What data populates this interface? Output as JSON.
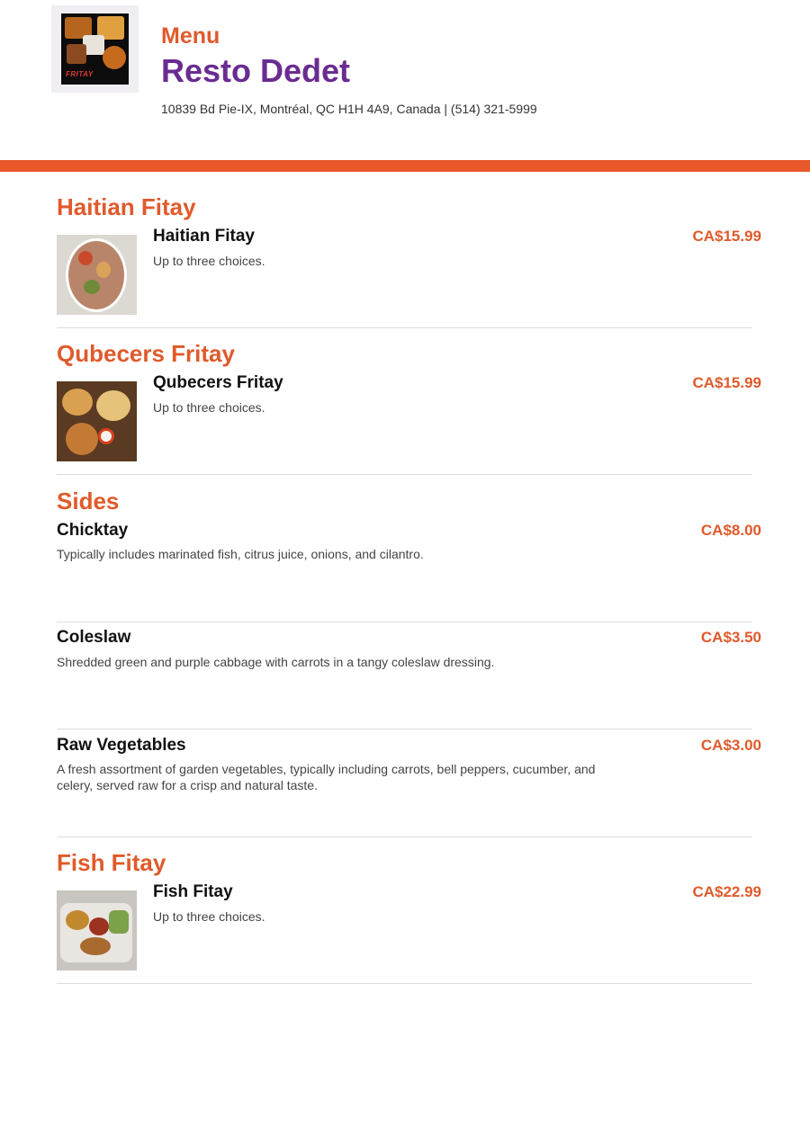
{
  "header": {
    "logo_text": "FRITAY",
    "menu_label": "Menu",
    "restaurant_name": "Resto Dedet",
    "address": "10839 Bd Pie-IX, Montréal, QC H1H 4A9, Canada | (514) 321-5999"
  },
  "colors": {
    "accent": "#e05a2b",
    "bar": "#e8582a",
    "brand": "#6a2c91"
  },
  "sections": [
    {
      "title": "Haitian Fitay",
      "items": [
        {
          "name": "Haitian Fitay",
          "description": "Up to three choices.",
          "price": "CA$15.99"
        }
      ]
    },
    {
      "title": "Qubecers Fritay",
      "items": [
        {
          "name": "Qubecers Fritay",
          "description": "Up to three choices.",
          "price": "CA$15.99"
        }
      ]
    },
    {
      "title": "Sides",
      "items": [
        {
          "name": "Chicktay",
          "description": "Typically includes marinated fish, citrus juice, onions, and cilantro.",
          "price": "CA$8.00"
        },
        {
          "name": "Coleslaw",
          "description": "Shredded green and purple cabbage with carrots in a tangy coleslaw dressing.",
          "price": "CA$3.50"
        },
        {
          "name": "Raw Vegetables",
          "description": "A fresh assortment of garden vegetables, typically including carrots, bell peppers, cucumber, and celery, served raw for a crisp and natural taste.",
          "price": "CA$3.00"
        }
      ]
    },
    {
      "title": "Fish Fitay",
      "items": [
        {
          "name": "Fish Fitay",
          "description": "Up to three choices.",
          "price": "CA$22.99"
        }
      ]
    }
  ]
}
